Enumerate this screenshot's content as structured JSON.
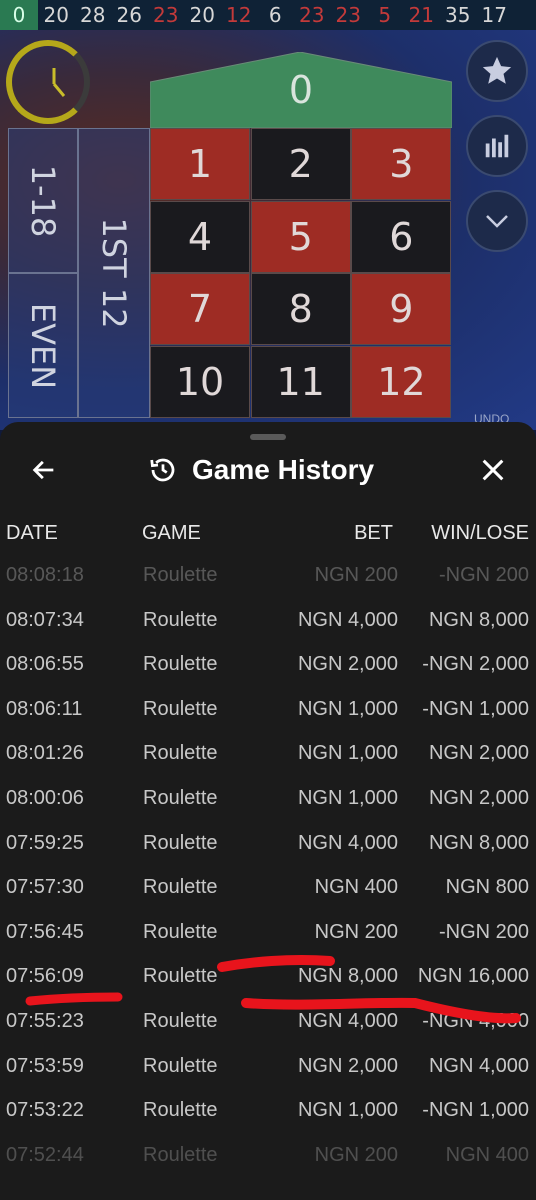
{
  "results": [
    {
      "value": "0",
      "color": "green"
    },
    {
      "value": "20",
      "color": "black"
    },
    {
      "value": "28",
      "color": "black"
    },
    {
      "value": "26",
      "color": "black"
    },
    {
      "value": "23",
      "color": "red"
    },
    {
      "value": "20",
      "color": "black"
    },
    {
      "value": "12",
      "color": "red"
    },
    {
      "value": "6",
      "color": "black"
    },
    {
      "value": "23",
      "color": "red"
    },
    {
      "value": "23",
      "color": "red"
    },
    {
      "value": "5",
      "color": "red"
    },
    {
      "value": "21",
      "color": "red"
    },
    {
      "value": "35",
      "color": "black"
    },
    {
      "value": "17",
      "color": "black"
    }
  ],
  "table": {
    "zero": "0",
    "outside": {
      "low": "1-18",
      "even": "EVEN",
      "dozen": "1ST 12"
    },
    "numbers": [
      {
        "n": "1",
        "color": "red"
      },
      {
        "n": "2",
        "color": "black"
      },
      {
        "n": "3",
        "color": "red"
      },
      {
        "n": "4",
        "color": "black"
      },
      {
        "n": "5",
        "color": "red"
      },
      {
        "n": "6",
        "color": "black"
      },
      {
        "n": "7",
        "color": "red"
      },
      {
        "n": "8",
        "color": "black"
      },
      {
        "n": "9",
        "color": "red"
      },
      {
        "n": "10",
        "color": "black"
      },
      {
        "n": "11",
        "color": "black"
      },
      {
        "n": "12",
        "color": "red"
      }
    ],
    "undo_label": "UNDO"
  },
  "panel": {
    "title": "Game History",
    "columns": {
      "date": "DATE",
      "game": "GAME",
      "bet": "BET",
      "win": "WIN/LOSE"
    },
    "rows": [
      {
        "date": "08:08:18",
        "game": "Roulette",
        "bet": "NGN 200",
        "win": "-NGN 200"
      },
      {
        "date": "08:07:34",
        "game": "Roulette",
        "bet": "NGN 4,000",
        "win": "NGN 8,000"
      },
      {
        "date": "08:06:55",
        "game": "Roulette",
        "bet": "NGN 2,000",
        "win": "-NGN 2,000"
      },
      {
        "date": "08:06:11",
        "game": "Roulette",
        "bet": "NGN 1,000",
        "win": "-NGN 1,000"
      },
      {
        "date": "08:01:26",
        "game": "Roulette",
        "bet": "NGN 1,000",
        "win": "NGN 2,000"
      },
      {
        "date": "08:00:06",
        "game": "Roulette",
        "bet": "NGN 1,000",
        "win": "NGN 2,000"
      },
      {
        "date": "07:59:25",
        "game": "Roulette",
        "bet": "NGN 4,000",
        "win": "NGN 8,000"
      },
      {
        "date": "07:57:30",
        "game": "Roulette",
        "bet": "NGN 400",
        "win": "NGN 800"
      },
      {
        "date": "07:56:45",
        "game": "Roulette",
        "bet": "NGN 200",
        "win": "-NGN 200"
      },
      {
        "date": "07:56:09",
        "game": "Roulette",
        "bet": "NGN 8,000",
        "win": "NGN 16,000"
      },
      {
        "date": "07:55:23",
        "game": "Roulette",
        "bet": "NGN 4,000",
        "win": "-NGN 4,000"
      },
      {
        "date": "07:53:59",
        "game": "Roulette",
        "bet": "NGN 2,000",
        "win": "NGN 4,000"
      },
      {
        "date": "07:53:22",
        "game": "Roulette",
        "bet": "NGN 1,000",
        "win": "-NGN 1,000"
      },
      {
        "date": "07:52:44",
        "game": "Roulette",
        "bet": "NGN 200",
        "win": "NGN 400"
      }
    ]
  },
  "icons": {
    "timer": "clock-icon",
    "favorite": "star-icon",
    "stats": "bar-chart-icon",
    "collapse": "chevron-down-icon",
    "back": "arrow-left-icon",
    "history": "history-icon",
    "close": "close-icon"
  },
  "colors": {
    "red": "#c33a3a",
    "green": "#2a7a52",
    "panel": "#1b1b1b",
    "annotation": "#e8141c"
  }
}
